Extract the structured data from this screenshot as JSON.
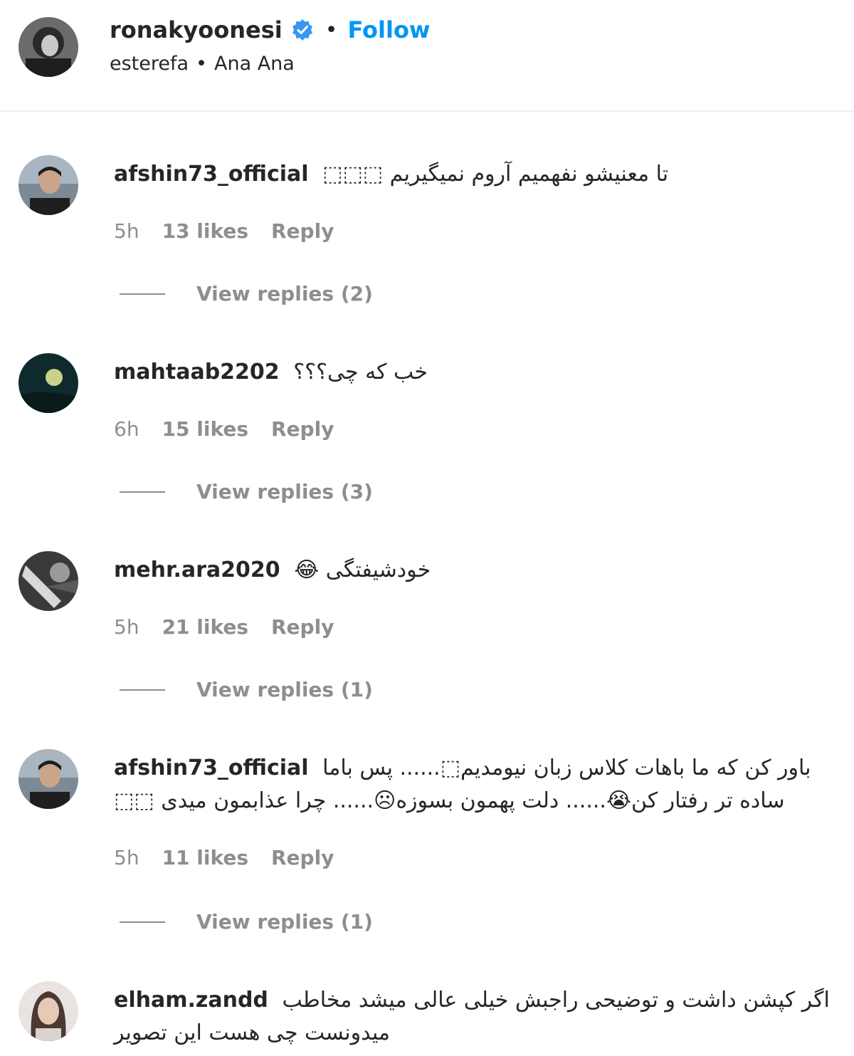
{
  "header": {
    "username": "ronakyoonesi",
    "follow_label": "Follow",
    "location": "esterefa",
    "audio": "Ana Ana",
    "accent_color": "#0095f6"
  },
  "comments": [
    {
      "username": "afshin73_official",
      "text": "تا معنیشو نفهمیم آروم نمیگیریم ⬚⬚⬚",
      "time": "5h",
      "likes": "13 likes",
      "reply_label": "Reply",
      "view_replies": "View replies (2)"
    },
    {
      "username": "mahtaab2202",
      "text": "خب که چی؟؟؟",
      "time": "6h",
      "likes": "15 likes",
      "reply_label": "Reply",
      "view_replies": "View replies (3)"
    },
    {
      "username": "mehr.ara2020",
      "text": "خودشیفتگی 😂",
      "time": "5h",
      "likes": "21 likes",
      "reply_label": "Reply",
      "view_replies": "View replies (1)"
    },
    {
      "username": "afshin73_official",
      "text": "باور کن که ما باهات کلاس زبان نیومدیم⬚...... پس باما ساده تر رفتار کن😭...... دلت پهمون بسوزه☹...... چرا عذابمون میدی ⬚⬚",
      "time": "5h",
      "likes": "11 likes",
      "reply_label": "Reply",
      "view_replies": "View replies (1)"
    },
    {
      "username": "elham.zandd",
      "text": "اگر کپشن داشت و توضیحی راجبش خیلی عالی میشد مخاطب میدونست چی هست این تصویر"
    }
  ]
}
